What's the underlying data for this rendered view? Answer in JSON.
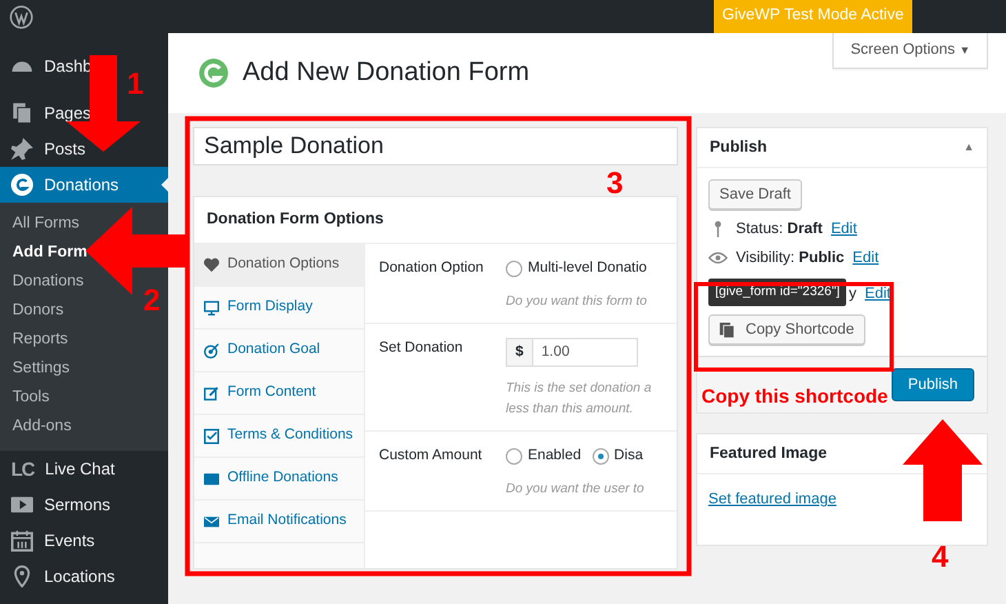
{
  "admin_bar": {
    "notice": "GiveWP Test Mode Active"
  },
  "sidebar": {
    "items": [
      {
        "label": "Dashb",
        "selected": false
      },
      {
        "label": "Pages",
        "selected": false
      },
      {
        "label": "Posts",
        "selected": false
      },
      {
        "label": "Donations",
        "selected": true,
        "children": [
          {
            "label": "All Forms",
            "selected": false
          },
          {
            "label": "Add Form",
            "selected": true
          },
          {
            "label": "Donations",
            "selected": false
          },
          {
            "label": "Donors",
            "selected": false
          },
          {
            "label": "Reports",
            "selected": false
          },
          {
            "label": "Settings",
            "selected": false
          },
          {
            "label": "Tools",
            "selected": false
          },
          {
            "label": "Add-ons",
            "selected": false
          }
        ]
      },
      {
        "label": "Live Chat",
        "logo_text": "LC",
        "selected": false
      },
      {
        "label": "Sermons",
        "selected": false
      },
      {
        "label": "Events",
        "selected": false
      },
      {
        "label": "Locations",
        "selected": false
      }
    ]
  },
  "header": {
    "title": "Add New Donation Form",
    "screen_options": "Screen Options",
    "caret": "▼"
  },
  "form": {
    "title_value": "Sample Donation",
    "options_title": "Donation Form Options",
    "tabs": [
      {
        "label": "Donation Options",
        "selected": true
      },
      {
        "label": "Form Display",
        "selected": false
      },
      {
        "label": "Donation Goal",
        "selected": false
      },
      {
        "label": "Form Content",
        "selected": false
      },
      {
        "label": "Terms & Conditions",
        "selected": false
      },
      {
        "label": "Offline Donations",
        "selected": false
      },
      {
        "label": "Email Notifications",
        "selected": false
      }
    ],
    "fields": [
      {
        "kind": "radio",
        "label": "Donation Option",
        "options": [
          {
            "label": "Multi-level Donatio",
            "selected": false
          }
        ],
        "help": [
          "Do you want this form to"
        ]
      },
      {
        "kind": "money",
        "label": "Set Donation",
        "currency": "$",
        "value": "1.00",
        "help": [
          "This is the set donation a",
          "less than this amount."
        ]
      },
      {
        "kind": "radio",
        "label": "Custom Amount",
        "options": [
          {
            "label": "Enabled",
            "selected": false
          },
          {
            "label": "Disa",
            "selected": true
          }
        ],
        "help": [
          "Do you want the user to"
        ]
      }
    ]
  },
  "publish": {
    "title": "Publish",
    "collapse": "▲",
    "save_draft": "Save Draft",
    "rows": [
      {
        "label": "Status:",
        "value": "Draft",
        "link": "Edit"
      },
      {
        "label": "Visibility:",
        "value": "Public",
        "link": "Edit"
      }
    ],
    "sticky_fragment": "y",
    "sticky_link": "Edit",
    "tooltip": "[give_form id=\"2326\"]",
    "copy_button": "Copy Shortcode",
    "publish_button": "Publish"
  },
  "featured_image": {
    "title": "Featured Image",
    "link": "Set featured image"
  },
  "annotations": [
    {
      "kind": "arrow_down",
      "number": "1"
    },
    {
      "kind": "arrow_left",
      "number": "2"
    },
    {
      "kind": "box",
      "number": "3"
    },
    {
      "kind": "arrow_up",
      "number": "4"
    },
    {
      "kind": "shortcode_box",
      "caption": "Copy this shortcode"
    }
  ]
}
